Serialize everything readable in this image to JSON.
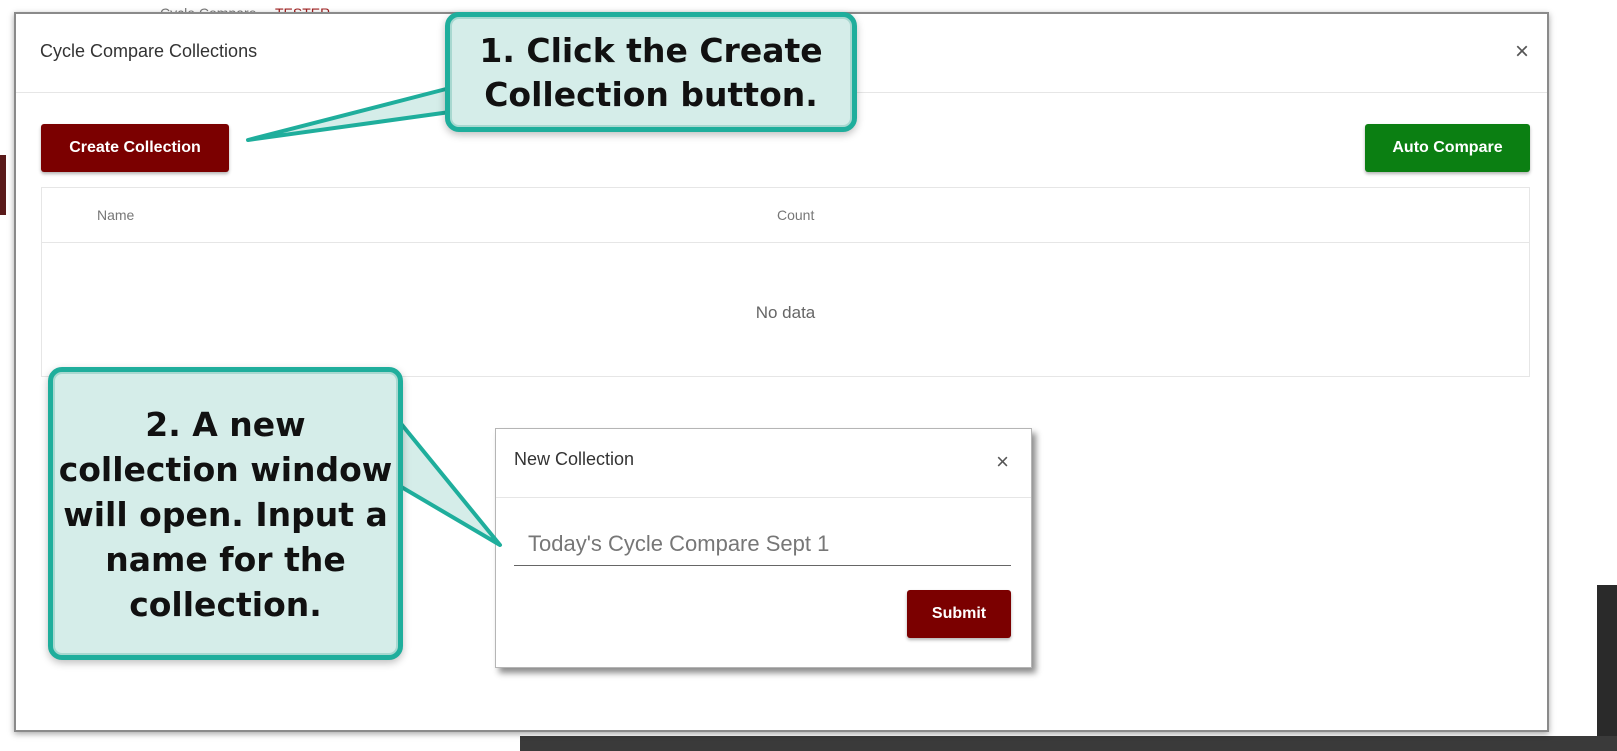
{
  "background": {
    "header_text_left": "Cycle Compare",
    "header_text_right": "TESTER"
  },
  "modal": {
    "title": "Cycle Compare Collections",
    "close_glyph": "×",
    "create_button_label": "Create Collection",
    "auto_compare_label": "Auto Compare",
    "table": {
      "columns": [
        "Name",
        "Count"
      ],
      "empty_text": "No data"
    }
  },
  "dialog": {
    "title": "New Collection",
    "close_glyph": "×",
    "input_value": "Today's Cycle Compare Sept 1",
    "submit_label": "Submit"
  },
  "callouts": {
    "step1": "1. Click the Create Collection button.",
    "step2": "2. A new collection window will open. Input a name for the collection."
  },
  "colors": {
    "primary_dark_red": "#7b0000",
    "auto_compare_green": "#0b7f12",
    "callout_border": "#1fae9c",
    "callout_fill": "#d5ede9"
  },
  "icons": {
    "close": "close-icon"
  }
}
